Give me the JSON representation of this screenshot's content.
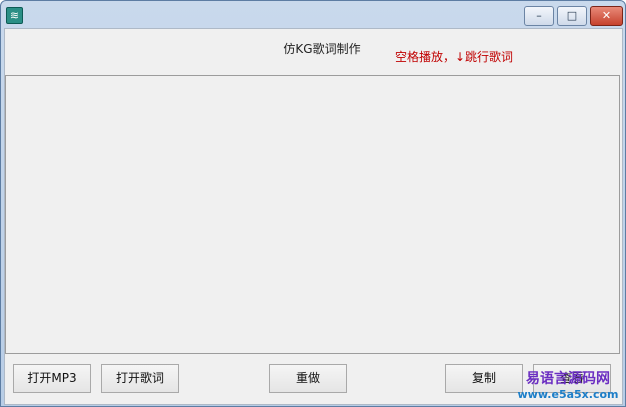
{
  "window": {
    "app_icon_glyph": "≋",
    "buttons": {
      "minimize": "–",
      "maximize": "□",
      "close": "✕"
    }
  },
  "header": {
    "title": "仿KG歌词制作",
    "hint": "空格播放，↓跳行歌词"
  },
  "buttons": {
    "open_mp3": "打开MP3",
    "open_lyrics": "打开歌词",
    "redo": "重做",
    "copy": "复制",
    "view": "查看"
  },
  "watermark": {
    "brand": "易语言源码网",
    "url": "www.e5a5x.com"
  }
}
